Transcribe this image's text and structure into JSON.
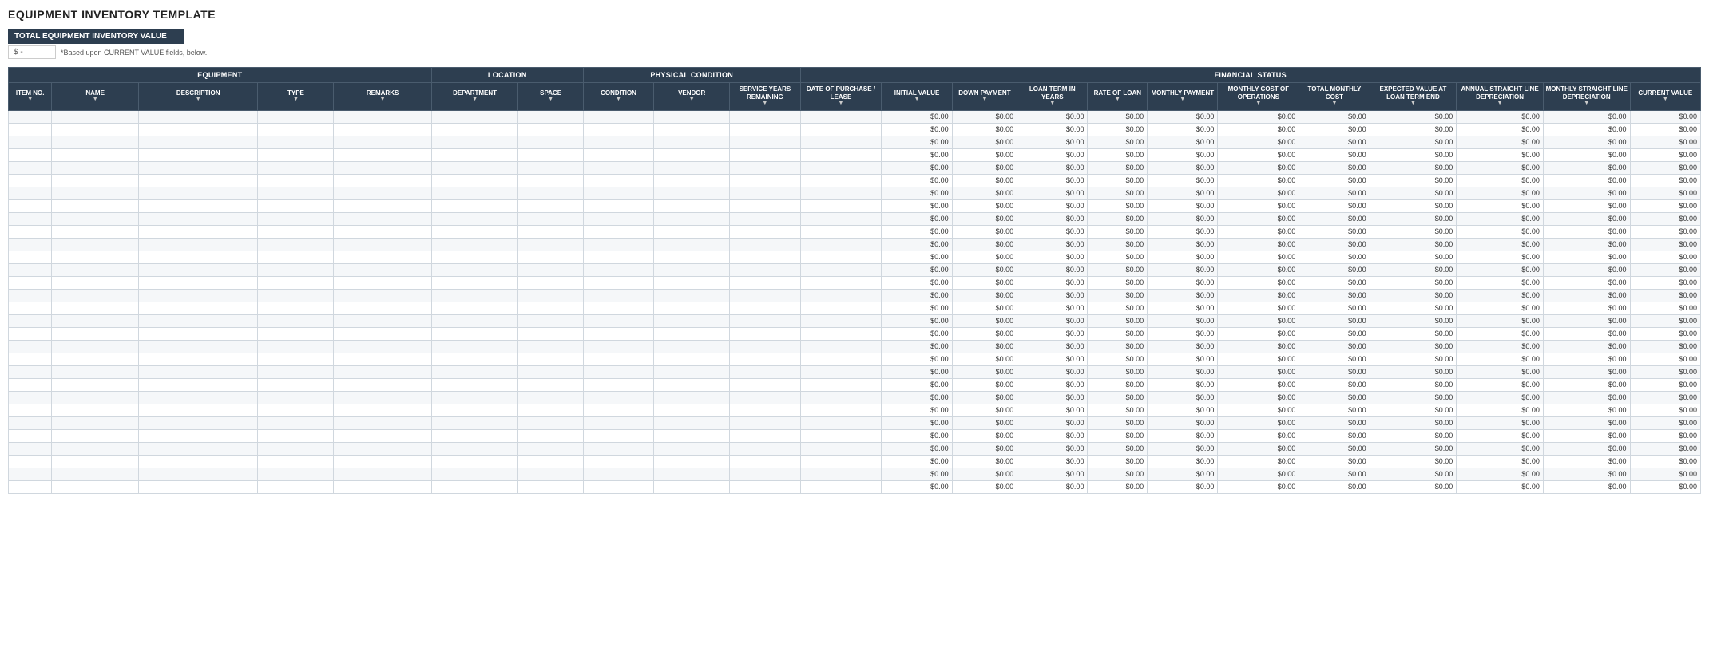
{
  "title": "EQUIPMENT INVENTORY TEMPLATE",
  "summary": {
    "label": "TOTAL EQUIPMENT INVENTORY VALUE",
    "value": "$      -",
    "note": "*Based upon CURRENT VALUE fields, below."
  },
  "groups": {
    "equipment": "EQUIPMENT",
    "location": "LOCATION",
    "physical": "PHYSICAL CONDITION",
    "financial": "FINANCIAL STATUS"
  },
  "columns": [
    {
      "id": "item_no",
      "label": "ITEM NO.",
      "group": "equipment"
    },
    {
      "id": "name",
      "label": "NAME",
      "group": "equipment"
    },
    {
      "id": "description",
      "label": "DESCRIPTION",
      "group": "equipment"
    },
    {
      "id": "type",
      "label": "TYPE",
      "group": "equipment"
    },
    {
      "id": "remarks",
      "label": "REMARKS",
      "group": "equipment"
    },
    {
      "id": "department",
      "label": "DEPARTMENT",
      "group": "location"
    },
    {
      "id": "space",
      "label": "SPACE",
      "group": "location"
    },
    {
      "id": "condition",
      "label": "CONDITION",
      "group": "physical"
    },
    {
      "id": "vendor",
      "label": "VENDOR",
      "group": "physical"
    },
    {
      "id": "service_years",
      "label": "SERVICE YEARS REMAINING",
      "group": "physical"
    },
    {
      "id": "date_purchase",
      "label": "DATE OF PURCHASE / LEASE",
      "group": "financial"
    },
    {
      "id": "initial_value",
      "label": "INITIAL VALUE",
      "group": "financial"
    },
    {
      "id": "down_payment",
      "label": "DOWN PAYMENT",
      "group": "financial"
    },
    {
      "id": "loan_term",
      "label": "LOAN TERM IN YEARS",
      "group": "financial"
    },
    {
      "id": "rate_of_loan",
      "label": "RATE OF LOAN",
      "group": "financial"
    },
    {
      "id": "monthly_payment",
      "label": "MONTHLY PAYMENT",
      "group": "financial"
    },
    {
      "id": "monthly_cost_ops",
      "label": "MONTHLY COST OF OPERATIONS",
      "group": "financial"
    },
    {
      "id": "total_monthly_cost",
      "label": "TOTAL MONTHLY COST",
      "group": "financial"
    },
    {
      "id": "expected_value",
      "label": "EXPECTED VALUE AT LOAN TERM END",
      "group": "financial"
    },
    {
      "id": "annual_straight",
      "label": "ANNUAL STRAIGHT LINE DEPRECIATION",
      "group": "financial"
    },
    {
      "id": "monthly_straight",
      "label": "MONTHLY STRAIGHT LINE DEPRECIATION",
      "group": "financial"
    },
    {
      "id": "current_value",
      "label": "CURRENT VALUE",
      "group": "financial"
    }
  ],
  "empty_value": "$0.00",
  "row_count": 30
}
